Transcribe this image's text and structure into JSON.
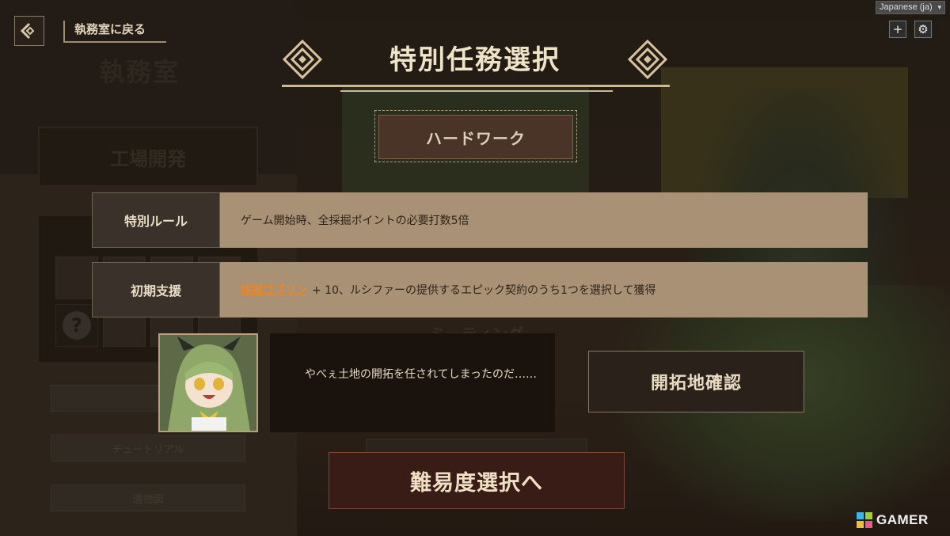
{
  "top_bar": {
    "back_label": "執務室に戻る",
    "language_select": "Japanese (ja)",
    "add_button": "+",
    "settings_icon": "gear-icon"
  },
  "background": {
    "faded_title": "執務室",
    "factory_label": "工場開発",
    "left_buttons": [
      "",
      "チュートリアル",
      "遺物図"
    ],
    "mid_button": "ミーティング"
  },
  "header": {
    "title": "特別任務選択"
  },
  "mode": {
    "label": "ハードワーク"
  },
  "rules": [
    {
      "label": "特別ルール",
      "text": "ゲーム開始時、全採掘ポイントの必要打数5倍"
    },
    {
      "label": "初期支援",
      "link": "採掘ゴブリン",
      "text": "+ 10、ルシファーの提供するエピック契約のうち1つを選択して獲得"
    }
  ],
  "dialogue": {
    "text": "やべぇ土地の開拓を任されてしまったのだ……"
  },
  "buttons": {
    "confirm_land": "開拓地確認",
    "next": "難易度選択へ"
  },
  "watermark": {
    "text": "GAMER"
  },
  "colors": {
    "accent_orange": "#e8882a",
    "panel_tan": "#a89174",
    "dark_brown": "#3a322a",
    "next_button": "#3a1c16"
  }
}
